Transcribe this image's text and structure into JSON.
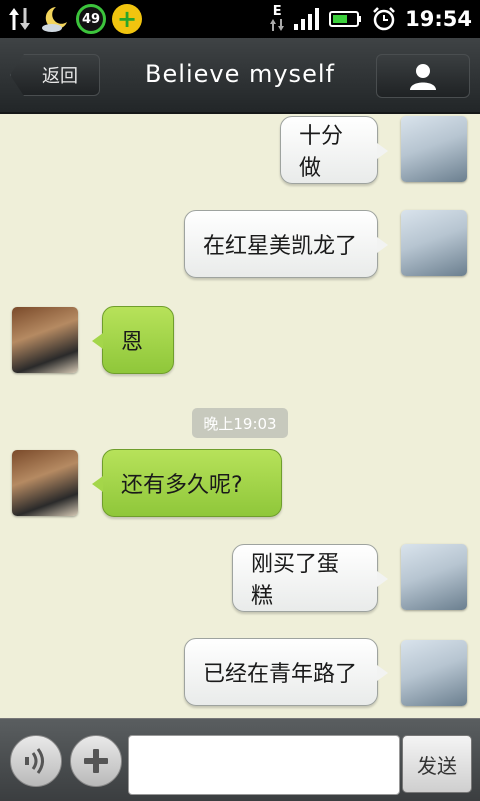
{
  "status_bar": {
    "battery_percent_badge": "49",
    "network_type": "E",
    "time": "19:54",
    "icons": [
      "data-transfer-icon",
      "weather-moon-icon",
      "cpu-badge-icon",
      "security-plus-icon",
      "signal-icon",
      "battery-icon",
      "alarm-icon"
    ]
  },
  "header": {
    "back_label": "返回",
    "title": "Believe myself",
    "profile_icon": "person-icon"
  },
  "messages": [
    {
      "side": "me",
      "text": "十分做"
    },
    {
      "side": "me",
      "text": "在红星美凯龙了"
    },
    {
      "side": "them",
      "text": "恩"
    },
    {
      "side": "them",
      "text": "还有多久呢?"
    },
    {
      "side": "me",
      "text": "刚买了蛋糕"
    },
    {
      "side": "me",
      "text": "已经在青年路了"
    }
  ],
  "timestamp": "晚上19:03",
  "input_bar": {
    "voice_icon": "voice-icon",
    "add_icon": "plus-icon",
    "input_value": "",
    "send_label": "发送"
  },
  "colors": {
    "chat_background": "#efefd9",
    "incoming_bubble": "#a4d64a",
    "outgoing_bubble": "#f2f3f2",
    "title_bar": "#2e3234"
  }
}
